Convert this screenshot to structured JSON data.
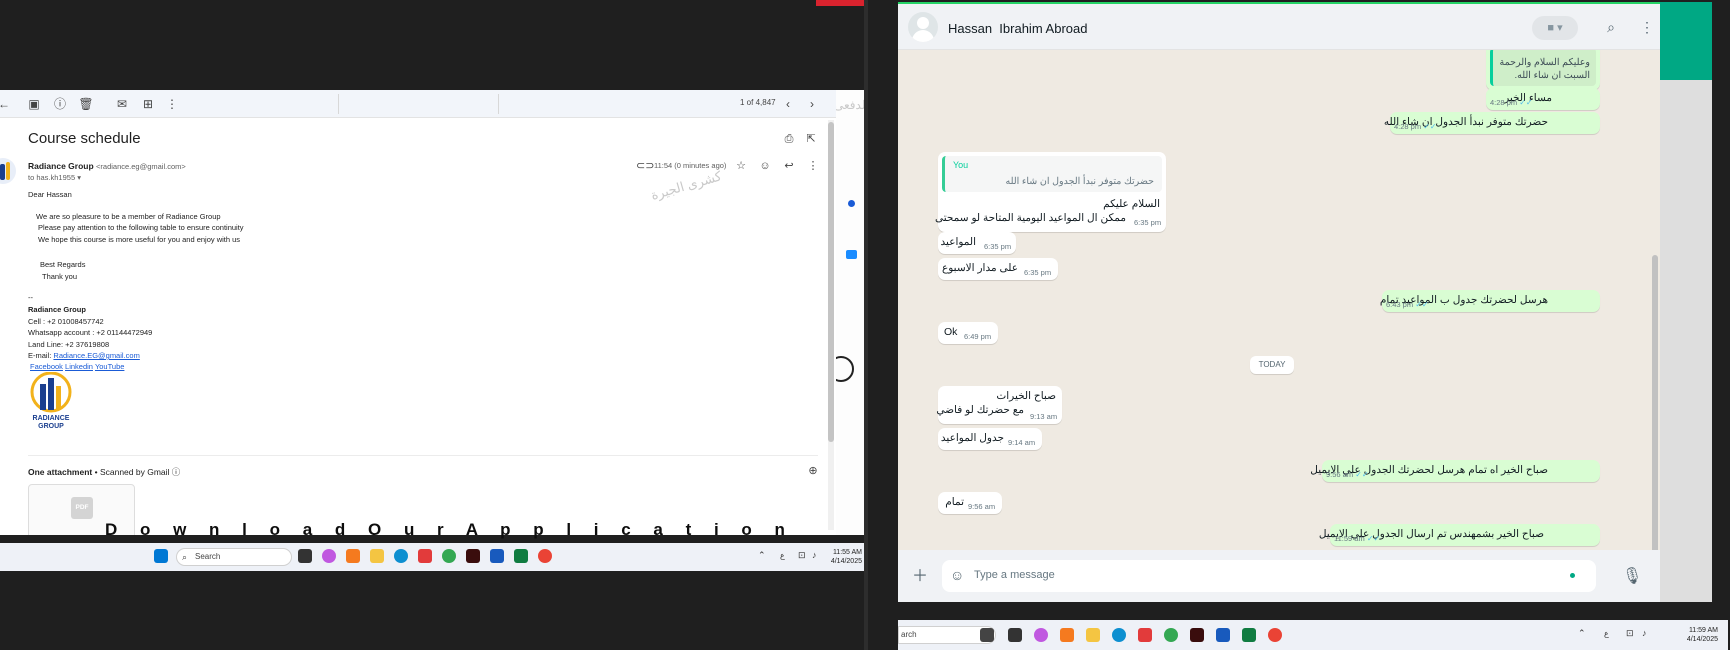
{
  "gmail": {
    "page_count": "1 of 4,847",
    "subject": "Course schedule",
    "sender_name": "Radiance Group",
    "sender_email": "<radiance.eg@gmail.com>",
    "to_line": "to has.kh1955",
    "time": "11:54 (0 minutes ago)",
    "body": {
      "greeting": "Dear  Hassan",
      "line1": "We are so pleasure to be a member of Radiance Group",
      "line2": "Please pay attention to the following table to ensure continuity",
      "line3": "We hope this course is more useful for you and enjoy with us",
      "regards": "Best Regards",
      "thanks": "Thank you"
    },
    "signature": {
      "dashes": "--",
      "company": "Radiance Group",
      "cell": "Cell : +2 01008457742",
      "whatsapp": "Whatsapp account : +2 01144472949",
      "landline": "Land Line: +2 37619808",
      "email_label": "E-mail: ",
      "email": "Radiance.EG@gmail.com",
      "facebook": "Facebook",
      "linkedin": "Linkedin",
      "youtube": "YouTube",
      "logo_line1": "RADIANCE",
      "logo_line2": "GROUP"
    },
    "attachment": {
      "title": "One attachment",
      "scanned": " • Scanned by Gmail",
      "file_type": "PDF"
    },
    "background_text": "D o w n l o a d   O u r   A p p l i c a t i o n",
    "watermark": "كشرى الجيرة",
    "watermark2": "الدفعى"
  },
  "taskbar_left": {
    "search_placeholder": "Search",
    "time": "11:55 AM",
    "date": "4/14/2025",
    "lang": "ع"
  },
  "whatsapp": {
    "contact": "Hassan  Ibrahim Abroad",
    "input_placeholder": "Type a message",
    "today_label": "TODAY",
    "colors": {
      "outgoing": "#d9fdd3",
      "incoming": "#ffffff",
      "accent": "#00a884",
      "tick": "#53bdeb"
    },
    "messages": [
      {
        "dir": "out",
        "quote": "وعليكم السلام والرحمة\nالسبت ان شاء الله.",
        "text": "",
        "time": ""
      },
      {
        "dir": "out",
        "text": "مساء الخير",
        "time": "4:28 pm"
      },
      {
        "dir": "out",
        "text": "حضرتك متوفر نبدأ الجدول ان شاء الله",
        "time": "4:28 pm"
      },
      {
        "dir": "in",
        "quote_author": "You",
        "quote": "حضرتك متوفر نبدأ الجدول ان شاء الله",
        "text": "السلام عليكم",
        "text2": "ممكن ال المواعيد اليومية المتاحة لو سمحتى",
        "time": "6:35 pm"
      },
      {
        "dir": "in",
        "text": "المواعيد",
        "time": "6:35 pm"
      },
      {
        "dir": "in",
        "text": "على مدار الاسبوع",
        "time": "6:35 pm"
      },
      {
        "dir": "out",
        "text": "هرسل لحضرتك جدول ب المواعيد تمام",
        "time": "6:43 pm"
      },
      {
        "dir": "in",
        "text": "Ok",
        "time": "6:49 pm"
      },
      {
        "dir": "in",
        "text": "صباح الخيرات",
        "text2": "مع حضرتك لو فاضي",
        "time": "9:13 am"
      },
      {
        "dir": "in",
        "text": "جدول المواعيد",
        "time": "9:14 am"
      },
      {
        "dir": "out",
        "text": "صباح الخير اه تمام هرسل لحضرتك الجدول علي الايميل",
        "time": "9:56 am"
      },
      {
        "dir": "in",
        "text": "تمام",
        "time": "9:56 am"
      },
      {
        "dir": "out",
        "text": "صباح الخير بشمهندس تم ارسال الجدول علي الايميل",
        "time": "11:59 am"
      }
    ]
  },
  "taskbar_right": {
    "search_placeholder": "arch",
    "time": "11:59 AM",
    "date": "4/14/2025",
    "lang": "ع"
  }
}
